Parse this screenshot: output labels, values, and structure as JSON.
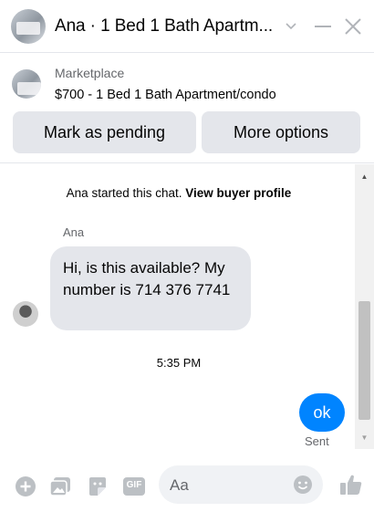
{
  "header": {
    "title": "Ana · 1 Bed 1 Bath Apartm...",
    "icons": [
      "chevron-down-icon",
      "minimize-icon",
      "close-icon"
    ]
  },
  "marketplace": {
    "label": "Marketplace",
    "listing": "$700 - 1 Bed 1 Bath Apartment/condo",
    "buttons": {
      "pending": "Mark as pending",
      "more": "More options"
    }
  },
  "chat": {
    "started_text": "Ana started this chat.",
    "profile_link": "View buyer profile",
    "sender_name": "Ana",
    "incoming_message": "Hi, is this available? My number is 714 376 7741",
    "timestamp": "5:35 PM",
    "outgoing_message": "ok",
    "status": "Sent"
  },
  "composer": {
    "placeholder": "Aa",
    "icons": [
      "plus-icon",
      "photo-icon",
      "sticker-icon",
      "gif-icon",
      "emoji-icon",
      "thumbs-up-icon"
    ],
    "gif_label": "GIF"
  },
  "colors": {
    "accent": "#0084ff",
    "icon": "#bcc0c4",
    "bubble_gray": "#e4e6eb"
  }
}
